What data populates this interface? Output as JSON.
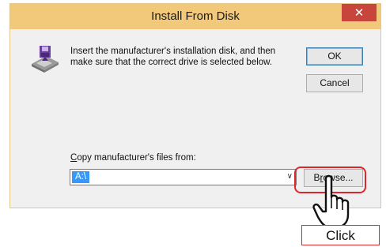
{
  "window": {
    "title": "Install From Disk",
    "close_glyph": "✕",
    "icon": "floppy-disk-icon"
  },
  "dialog": {
    "message": "Insert the manufacturer's installation disk, and then make sure that the correct drive is selected below.",
    "ok_label": "OK",
    "cancel_label": "Cancel",
    "copy_label": "Copy manufacturer's files from:",
    "copy_label_underline": "C",
    "copy_label_rest": "opy manufacturer's files from:",
    "path_value": "A:\\",
    "browse_label": "Browse...",
    "browse_label_pre": "B",
    "browse_label_underline": "r",
    "browse_label_post": "owse..."
  },
  "annotation": {
    "click_label": "Click",
    "cursor": "hand-pointer-icon",
    "highlight_color": "#e0262a"
  },
  "colors": {
    "titlebar": "#f2c97a",
    "close_button": "#c8453b",
    "selection": "#3399ff"
  }
}
